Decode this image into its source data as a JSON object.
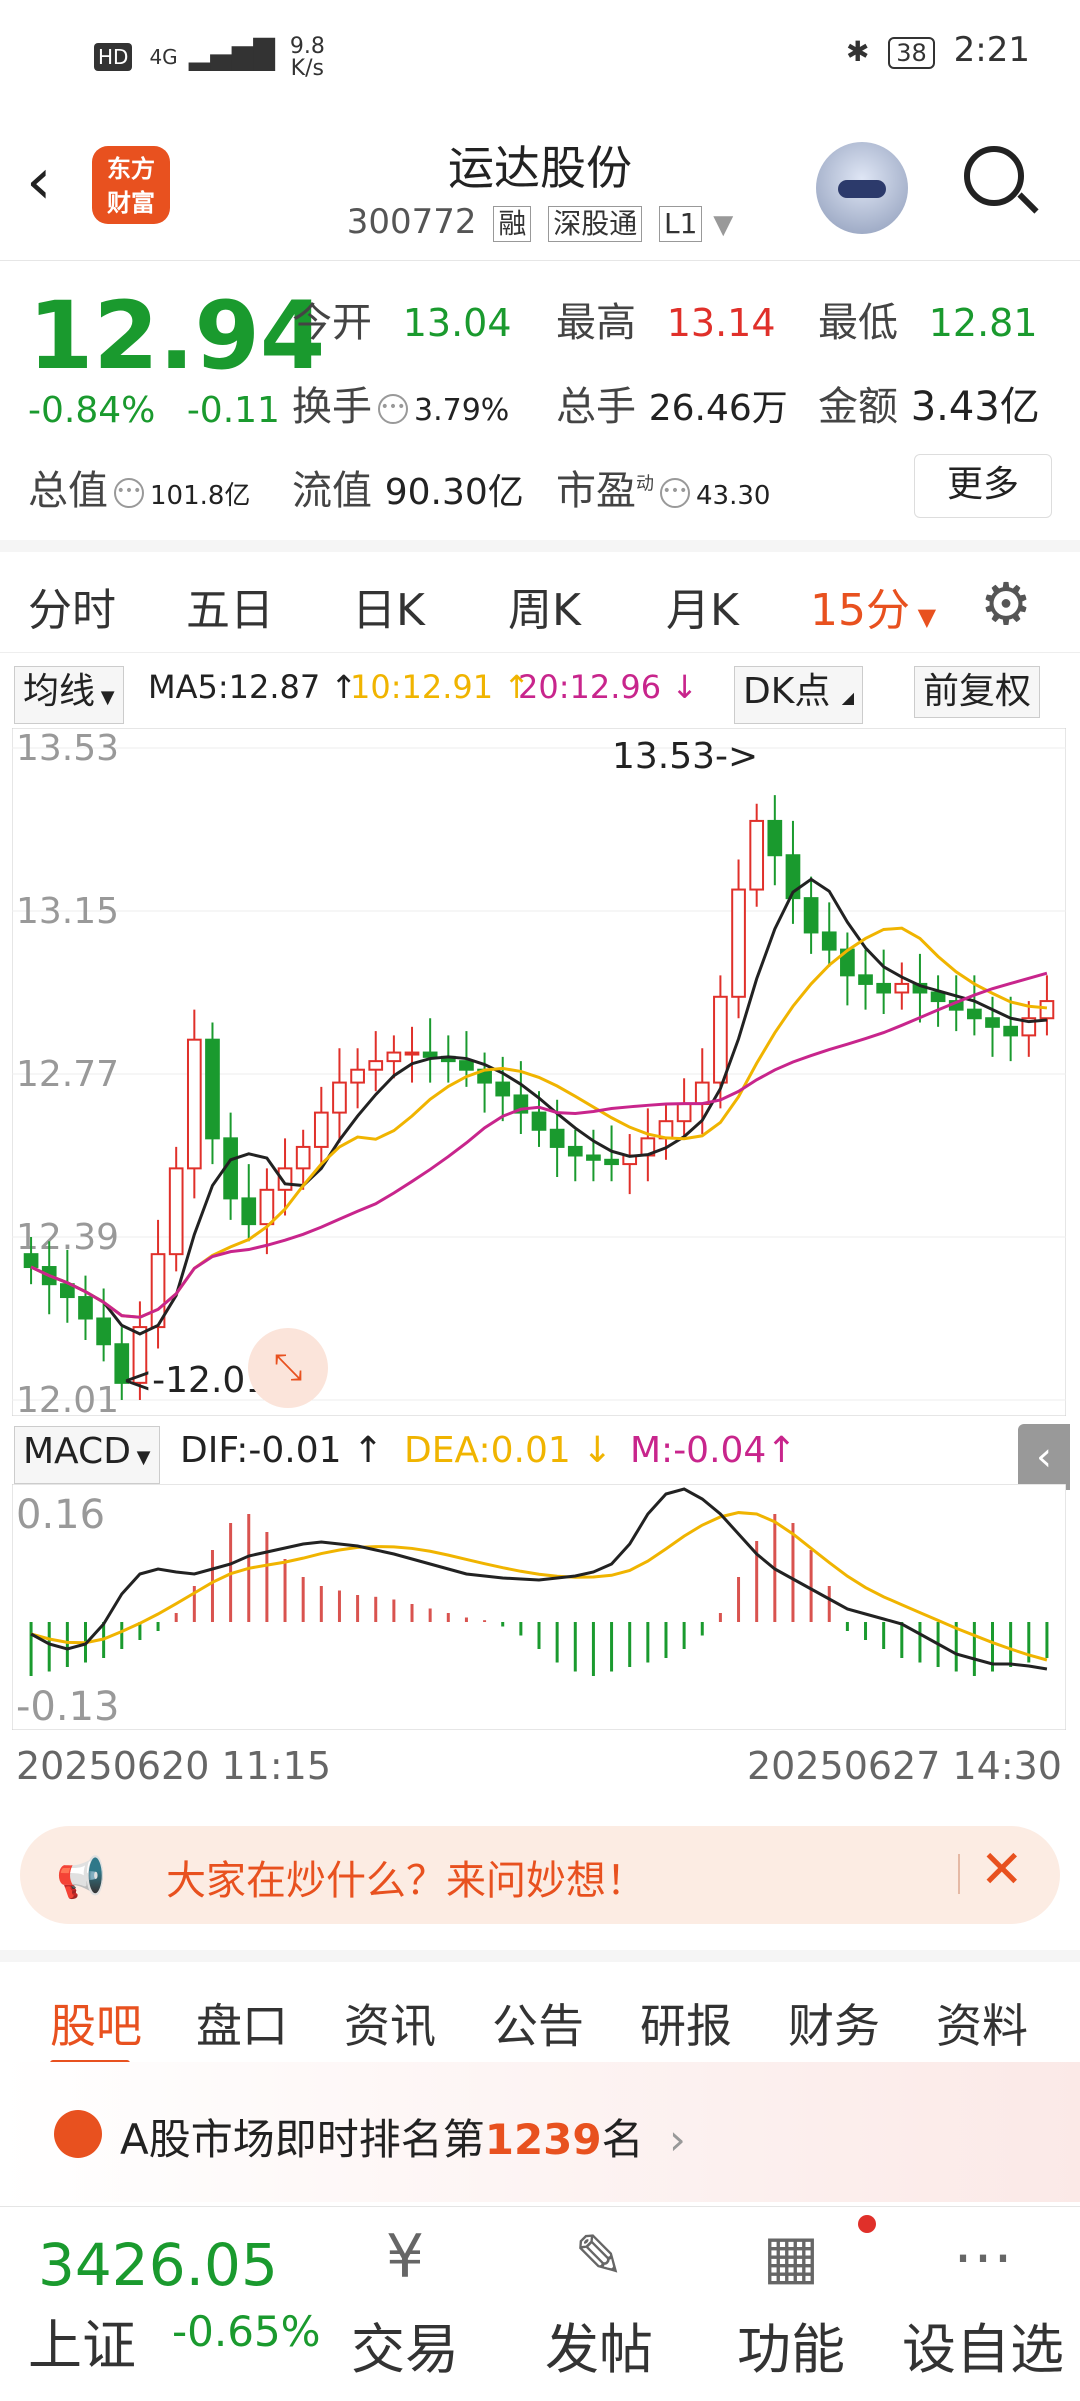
{
  "status": {
    "hd": "HD",
    "net": "4G",
    "speed_top": "9.8",
    "speed_bottom": "K/s",
    "battery": "38",
    "time": "2:21"
  },
  "header": {
    "logo": "东方\n财富",
    "title": "运达股份",
    "code": "300772",
    "tags": [
      "融",
      "深股通",
      "L1"
    ]
  },
  "quote": {
    "price": "12.94",
    "change_pct": "-0.84%",
    "change": "-0.11",
    "open_label": "今开",
    "open": "13.04",
    "high_label": "最高",
    "high": "13.14",
    "low_label": "最低",
    "low": "12.81",
    "turnover_label": "换手",
    "turnover": "3.79%",
    "volume_label": "总手",
    "volume": "26.46万",
    "amount_label": "金额",
    "amount": "3.43亿",
    "mktcap_label": "总值",
    "mktcap": "101.8亿",
    "float_label": "流值",
    "float": "90.30亿",
    "pe_label": "市盈",
    "pe_sup": "动",
    "pe": "43.30",
    "more": "更多"
  },
  "tabs": [
    "分时",
    "五日",
    "日K",
    "周K",
    "月K",
    "15分"
  ],
  "ma": {
    "selector": "均线",
    "ma5": "MA5:12.87",
    "ma10": "10:12.91",
    "ma20": "20:12.96",
    "dk": "DK点",
    "fq": "前复权"
  },
  "chart_data": {
    "type": "candlestick",
    "y_ticks": [
      "13.53",
      "13.15",
      "12.77",
      "12.39",
      "12.01"
    ],
    "ylim": [
      12.01,
      13.53
    ],
    "high_annotation": "13.53->",
    "low_annotation": "<-12.01",
    "colors": {
      "up": "#e0302a",
      "down": "#1a9a2e",
      "ma5": "#222222",
      "ma10": "#f0b400",
      "ma20": "#c8258c"
    }
  },
  "macd": {
    "selector": "MACD",
    "dif": "DIF:-0.01",
    "dea": "DEA:0.01",
    "m": "M:-0.04",
    "y_top": "0.16",
    "y_bottom": "-0.13"
  },
  "dates": {
    "start": "20250620 11:15",
    "end": "20250627 14:30"
  },
  "banner": {
    "text": "大家在炒什么？来问妙想！"
  },
  "nav2": [
    "股吧",
    "盘口",
    "资讯",
    "公告",
    "研报",
    "财务",
    "资料"
  ],
  "rank": {
    "prefix": "A股市场即时排名第",
    "num": "1239",
    "suffix": "名"
  },
  "bottom": {
    "index_value": "3426.05",
    "index_name": "上证",
    "index_change": "-0.65%",
    "items": [
      "交易",
      "发帖",
      "功能",
      "设自选"
    ]
  }
}
